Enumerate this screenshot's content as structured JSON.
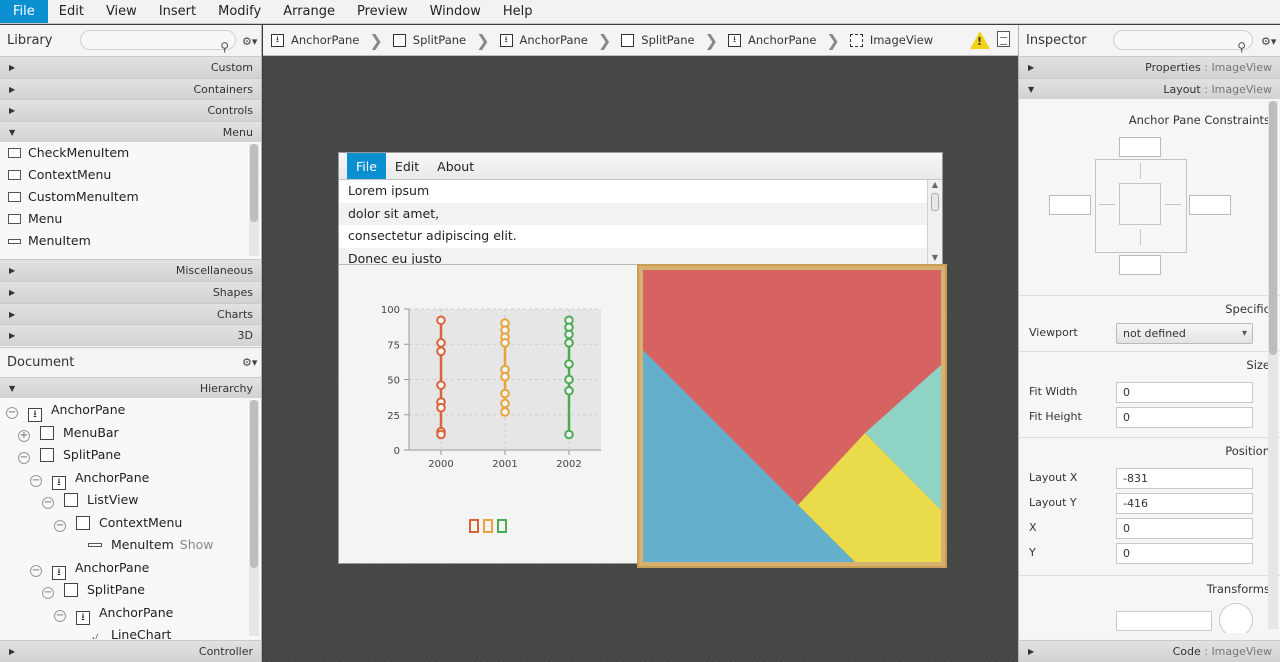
{
  "menubar": {
    "items": [
      "File",
      "Edit",
      "View",
      "Insert",
      "Modify",
      "Arrange",
      "Preview",
      "Window",
      "Help"
    ]
  },
  "library": {
    "title": "Library",
    "categories_top": [
      "Custom",
      "Containers",
      "Controls",
      "Menu"
    ],
    "menu_items": [
      "CheckMenuItem",
      "ContextMenu",
      "CustomMenuItem",
      "Menu",
      "MenuItem"
    ],
    "categories_bottom": [
      "Miscellaneous",
      "Shapes",
      "Charts",
      "3D"
    ]
  },
  "document": {
    "title": "Document",
    "hierarchy_label": "Hierarchy",
    "tree": [
      {
        "label": "AnchorPane",
        "extra": ""
      },
      {
        "label": "MenuBar",
        "extra": ""
      },
      {
        "label": "SplitPane",
        "extra": ""
      },
      {
        "label": "AnchorPane",
        "extra": ""
      },
      {
        "label": "ListView",
        "extra": ""
      },
      {
        "label": "ContextMenu",
        "extra": ""
      },
      {
        "label": "MenuItem",
        "extra": "Show"
      },
      {
        "label": "AnchorPane",
        "extra": ""
      },
      {
        "label": "SplitPane",
        "extra": ""
      },
      {
        "label": "AnchorPane",
        "extra": ""
      },
      {
        "label": "LineChart",
        "extra": ""
      }
    ],
    "controller_label": "Controller"
  },
  "breadcrumbs": [
    "AnchorPane",
    "SplitPane",
    "AnchorPane",
    "SplitPane",
    "AnchorPane",
    "ImageView"
  ],
  "preview": {
    "menu": [
      "File",
      "Edit",
      "About"
    ],
    "list": [
      "Lorem ipsum",
      "dolor sit amet,",
      "consectetur adipiscing elit.",
      "Donec eu justo"
    ]
  },
  "chart_data": {
    "type": "scatter",
    "x_categories": [
      "2000",
      "2001",
      "2002"
    ],
    "y_ticks": [
      "0",
      "25",
      "50",
      "75",
      "100"
    ],
    "ylim": [
      0,
      100
    ],
    "series": [
      {
        "color": "#d9643a",
        "category": "2000",
        "values": [
          92,
          76,
          70,
          46,
          34,
          30,
          13,
          11
        ]
      },
      {
        "color": "#e8a33a",
        "category": "2001",
        "values": [
          90,
          85,
          80,
          76,
          57,
          52,
          40,
          33,
          27
        ]
      },
      {
        "color": "#4caa55",
        "category": "2002",
        "values": [
          92,
          87,
          82,
          76,
          61,
          50,
          42,
          11
        ]
      }
    ]
  },
  "inspector": {
    "title": "Inspector",
    "properties_label": "Properties",
    "properties_target": "ImageView",
    "layout_label": "Layout",
    "layout_target": "ImageView",
    "constraints_label": "Anchor Pane Constraints",
    "specific_label": "Specific",
    "viewport_label": "Viewport",
    "viewport_value": "not defined",
    "size_label": "Size",
    "fit_width_label": "Fit Width",
    "fit_width_value": "0",
    "fit_height_label": "Fit Height",
    "fit_height_value": "0",
    "position_label": "Position",
    "layout_x_label": "Layout X",
    "layout_x_value": "-831",
    "layout_y_label": "Layout Y",
    "layout_y_value": "-416",
    "x_label": "X",
    "x_value": "0",
    "y_label": "Y",
    "y_value": "0",
    "transforms_label": "Transforms",
    "code_label": "Code",
    "code_target": "ImageView"
  }
}
